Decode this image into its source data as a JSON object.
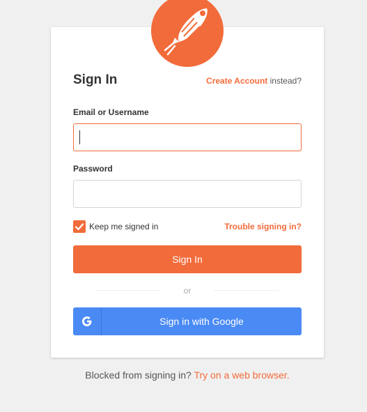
{
  "brand": {
    "accent_color": "#f26b3a",
    "google_color": "#4a8af4",
    "logo_icon": "postman-rocket-icon"
  },
  "header": {
    "title": "Sign In",
    "create_account_link": "Create Account",
    "create_account_suffix": "instead?"
  },
  "form": {
    "email_label": "Email or Username",
    "email_value": "",
    "password_label": "Password",
    "password_value": "",
    "keep_signed_in_label": "Keep me signed in",
    "keep_signed_in_checked": true,
    "trouble_link": "Trouble signing in?",
    "submit_label": "Sign In"
  },
  "divider": {
    "text": "or"
  },
  "google": {
    "icon": "google-g-icon",
    "label": "Sign in with Google"
  },
  "footer": {
    "blocked_text": "Blocked from signing in?",
    "browser_link": "Try on a web browser."
  }
}
